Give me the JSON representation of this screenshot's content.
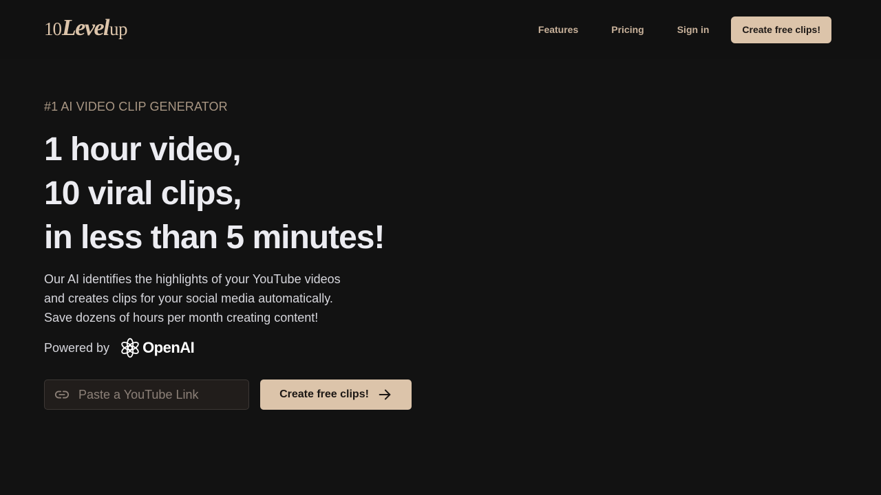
{
  "logo": {
    "part1": "10",
    "part2": "Level",
    "part3": "up"
  },
  "nav": {
    "items": [
      {
        "label": "Features"
      },
      {
        "label": "Pricing"
      },
      {
        "label": "Sign in"
      }
    ],
    "cta_label": "Create free clips!"
  },
  "hero": {
    "eyebrow": "#1 AI VIDEO CLIP GENERATOR",
    "headline": [
      "1 hour video,",
      "10 viral clips,",
      "in less than 5 minutes!"
    ],
    "description": [
      "Our AI identifies the highlights of your YouTube videos",
      "and creates clips for your social media automatically.",
      "Save dozens of hours per month creating content!"
    ],
    "powered_by_label": "Powered by",
    "powered_by_brand": "OpenAI",
    "input_placeholder": "Paste a YouTube Link",
    "input_value": "",
    "cta_label": "Create free clips!",
    "link_icon": "link-icon",
    "arrow_icon": "arrow-right-icon"
  },
  "colors": {
    "background": "#121212",
    "accent": "#dcc4aa",
    "eyebrow": "#a89683"
  }
}
